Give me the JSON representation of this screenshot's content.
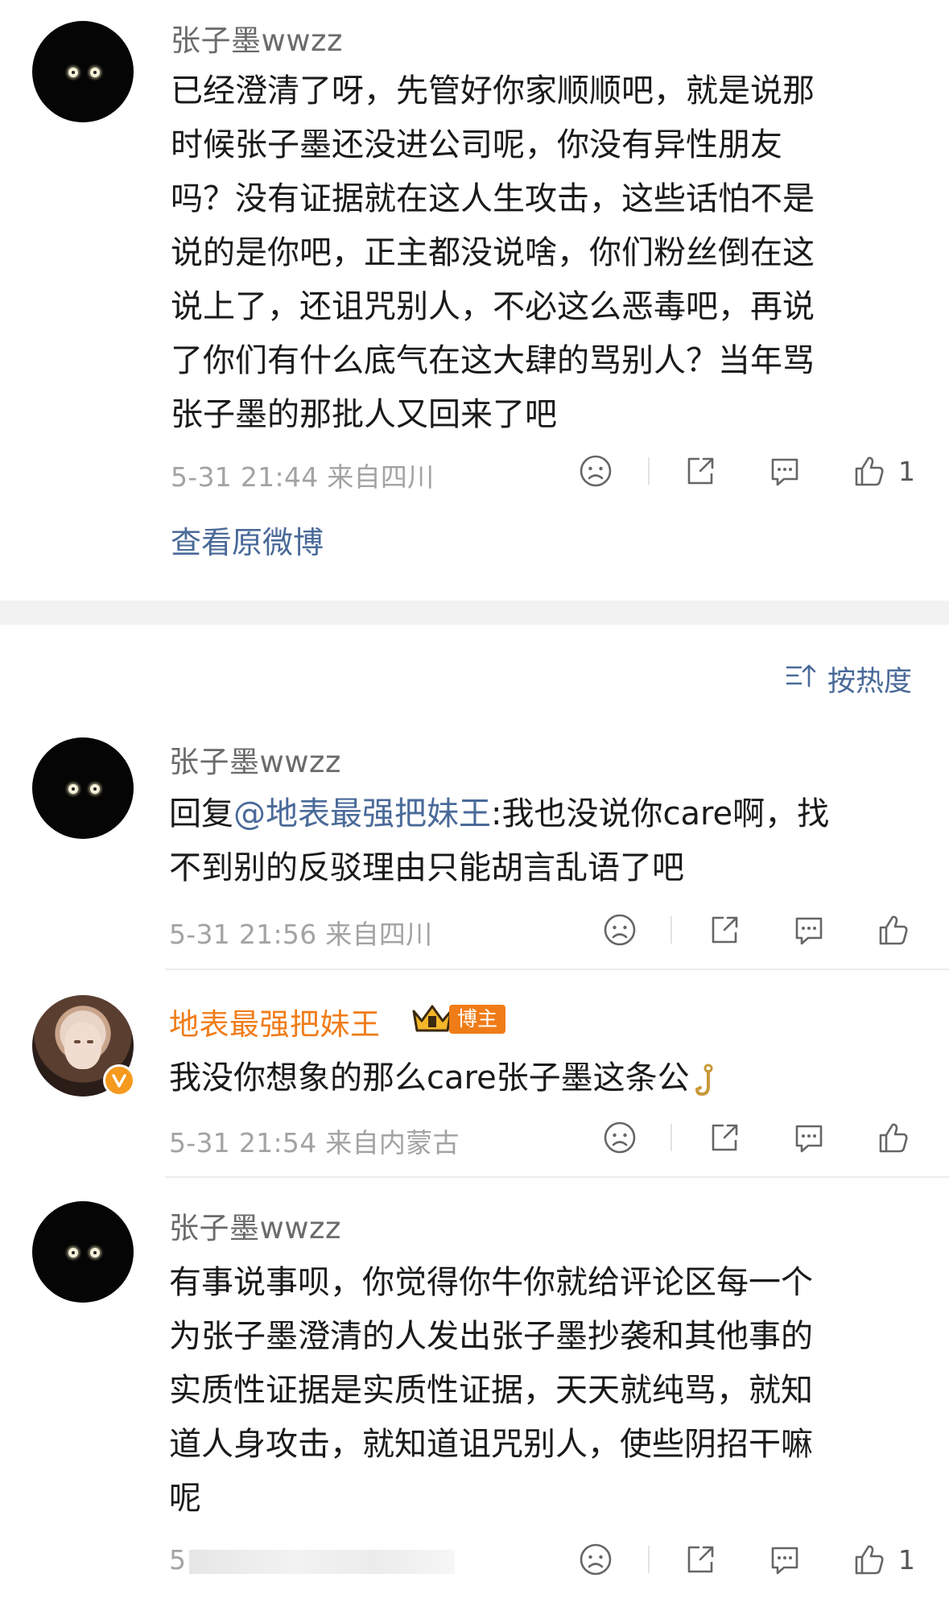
{
  "comment_top": {
    "username": "张子墨wwzz",
    "text": "已经澄清了呀，先管好你家顺顺吧，就是说那时候张子墨还没进公司呢，你没有异性朋友吗？没有证据就在这人生攻击，这些话怕不是说的是你吧，正主都没说啥，你们粉丝倒在这说上了，还诅咒别人，不必这么恶毒吧，再说了你们有什么底气在这大肆的骂别人？当年骂张子墨的那批人又回来了吧",
    "lines": [
      "已经澄清了呀，先管好你家顺顺吧，就是说那",
      "时候张子墨还没进公司呢，你没有异性朋友",
      "吗？没有证据就在这人生攻击，这些话怕不是",
      "说的是你吧，正主都没说啥，你们粉丝倒在这",
      "说上了，还诅咒别人，不必这么恶毒吧，再说",
      "了你们有什么底气在这大肆的骂别人？当年骂",
      "张子墨的那批人又回来了吧"
    ],
    "meta": "5-31 21:44  来自四川",
    "like_count": "1"
  },
  "view_original_link": "查看原微博",
  "sort_label": "按热度",
  "replies": [
    {
      "username": "张子墨wwzz",
      "reply_prefix": "回复",
      "mention": "@地表最强把妹王",
      "lines": [
        "回复@地表最强把妹王:我也没说你care啊，找",
        "不到别的反驳理由只能胡言乱语了吧"
      ],
      "text_after_mention": ":我也没说你care啊，找",
      "line2": "不到别的反驳理由只能胡言乱语了吧",
      "meta": "5-31 21:56  来自四川"
    },
    {
      "username": "地表最强把妹王",
      "badge": "博主",
      "text": "我没你想象的那么care张子墨这条公",
      "meta": "5-31 21:54  来自内蒙古"
    },
    {
      "username": "张子墨wwzz",
      "lines": [
        "有事说事呗，你觉得你牛你就给评论区每一个",
        "为张子墨澄清的人发出张子墨抄袭和其他事的",
        "实质性证据是实质性证据，天天就纯骂，就知",
        "道人身攻击，就知道诅咒别人，使些阴招干嘛",
        "呢"
      ],
      "meta": "5",
      "like_count": "1"
    }
  ],
  "icons": [
    "sad-face-icon",
    "share-icon",
    "comment-icon",
    "like-icon",
    "crown-icon",
    "verified-icon",
    "hook-emoji-icon",
    "sort-icon"
  ],
  "colors": {
    "link": "#4a6a99",
    "vip_name": "#f07c18",
    "meta": "#a3a3a3",
    "badge": "#f07c18"
  }
}
